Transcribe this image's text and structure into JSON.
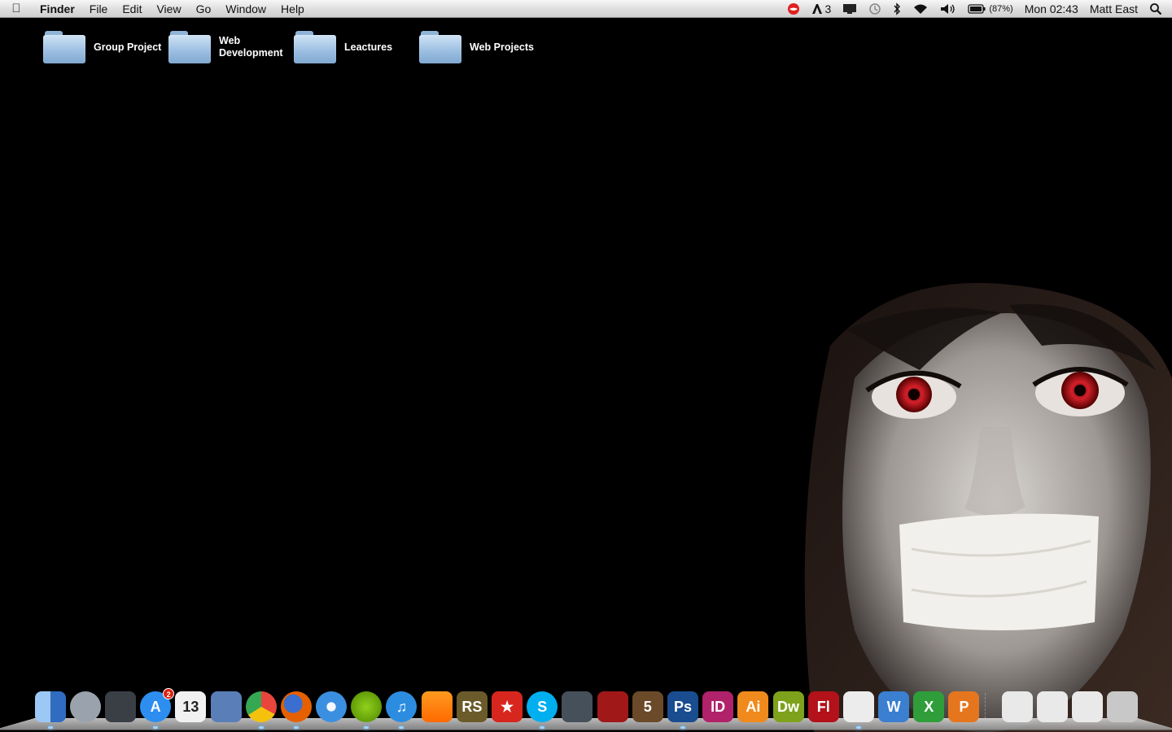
{
  "menubar": {
    "app_name": "Finder",
    "menus": [
      "File",
      "Edit",
      "View",
      "Go",
      "Window",
      "Help"
    ],
    "status": {
      "adobe_count": "3",
      "battery": "(87%)",
      "clock": "Mon 02:43",
      "user": "Matt East"
    }
  },
  "desktop": {
    "folders": [
      {
        "label": "Group Project"
      },
      {
        "label": "Web Development"
      },
      {
        "label": "Leactures"
      },
      {
        "label": "Web Projects"
      }
    ]
  },
  "dock": {
    "items": [
      {
        "name": "finder",
        "label": "",
        "color": "#4a90e2"
      },
      {
        "name": "launchpad",
        "label": "",
        "color": "#9aa3ad"
      },
      {
        "name": "mission-control",
        "label": "",
        "color": "#3a3f46"
      },
      {
        "name": "app-store",
        "label": "A",
        "color": "#2d8ef0",
        "badge": "2"
      },
      {
        "name": "ical",
        "label": "13",
        "color": "#f1f1f1"
      },
      {
        "name": "mail",
        "label": "",
        "color": "#5a7fb8"
      },
      {
        "name": "chrome",
        "label": "",
        "color": "#e8453c"
      },
      {
        "name": "firefox",
        "label": "",
        "color": "#e66000"
      },
      {
        "name": "safari",
        "label": "",
        "color": "#3b8fe0"
      },
      {
        "name": "spotify",
        "label": "",
        "color": "#7ab800"
      },
      {
        "name": "itunes",
        "label": "♫",
        "color": "#2c8de0"
      },
      {
        "name": "vlc",
        "label": "",
        "color": "#ff8800"
      },
      {
        "name": "runescape",
        "label": "RS",
        "color": "#6b5a2a"
      },
      {
        "name": "pokerstars",
        "label": "★",
        "color": "#d7261e"
      },
      {
        "name": "skype",
        "label": "S",
        "color": "#00aff0"
      },
      {
        "name": "facetime",
        "label": "",
        "color": "#45505a"
      },
      {
        "name": "photo-booth",
        "label": "",
        "color": "#a01818"
      },
      {
        "name": "aperture",
        "label": "5",
        "color": "#6b4a2a"
      },
      {
        "name": "photoshop",
        "label": "Ps",
        "color": "#1a4d8f"
      },
      {
        "name": "indesign",
        "label": "ID",
        "color": "#b0226a"
      },
      {
        "name": "illustrator",
        "label": "Ai",
        "color": "#f08a1c"
      },
      {
        "name": "dreamweaver",
        "label": "Dw",
        "color": "#7ea21b"
      },
      {
        "name": "flash",
        "label": "Fl",
        "color": "#b3121a"
      },
      {
        "name": "textedit",
        "label": "",
        "color": "#ececec"
      },
      {
        "name": "word",
        "label": "W",
        "color": "#3a7fd0"
      },
      {
        "name": "excel",
        "label": "X",
        "color": "#2f9e3a"
      },
      {
        "name": "powerpoint",
        "label": "P",
        "color": "#e6761e"
      },
      {
        "name": "downloads-stack",
        "label": "",
        "color": "#e9e9e9"
      },
      {
        "name": "documents-stack",
        "label": "",
        "color": "#e9e9e9"
      },
      {
        "name": "applications-stack",
        "label": "",
        "color": "#e9e9e9"
      },
      {
        "name": "trash",
        "label": "",
        "color": "#c8c8c8"
      }
    ]
  }
}
